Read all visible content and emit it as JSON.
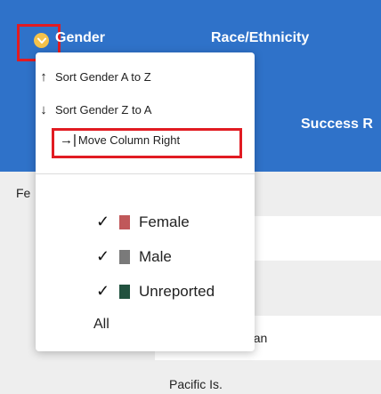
{
  "header": {
    "gender_label": "Gender",
    "race_label": "Race/Ethnicity",
    "success_label": "Success R"
  },
  "table": {
    "fe_label": "Fe",
    "rican_label": "rican",
    "pacific_label": "Pacific Is."
  },
  "menu": {
    "sort_az": "Sort Gender A to Z",
    "sort_za": "Sort Gender Z to A",
    "move_right": "Move Column Right",
    "filters": [
      {
        "label": "Female",
        "checked": true,
        "color": "#c0585a"
      },
      {
        "label": "Male",
        "checked": true,
        "color": "#7a7a7a"
      },
      {
        "label": "Unreported",
        "checked": true,
        "color": "#22523f"
      }
    ],
    "all_label": "All"
  },
  "colors": {
    "header_blue": "#2f72c9",
    "sort_button": "#f5c24b",
    "highlight_red": "#e11b22"
  },
  "icons": {
    "sort_button_icon": "chevron-down-icon",
    "sort_az_icon": "arrow-up-icon",
    "sort_za_icon": "arrow-down-icon",
    "move_right_icon": "arrow-right-bar-icon",
    "check_icon": "check-icon"
  }
}
